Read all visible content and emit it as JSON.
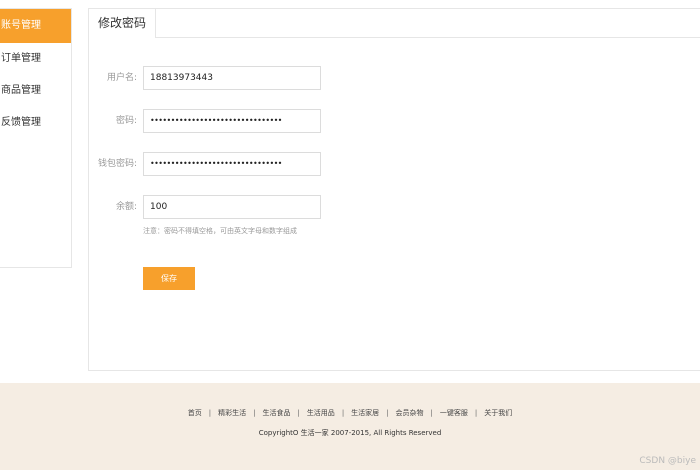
{
  "sidebar": {
    "items": [
      {
        "label": "账号管理"
      },
      {
        "label": "订单管理"
      },
      {
        "label": "商品管理"
      },
      {
        "label": "反馈管理"
      }
    ]
  },
  "panel": {
    "tab_label": "修改密码"
  },
  "form": {
    "username_label": "用户名:",
    "username_value": "18813973443",
    "password_label": "密码:",
    "password_value": "••••••••••••••••••••••••••••••••",
    "wallet_password_label": "钱包密码:",
    "wallet_password_value": "••••••••••••••••••••••••••••••••",
    "balance_label": "余额:",
    "balance_value": "100",
    "hint": "注意：密码不得填空格，可由英文字母和数字组成",
    "save_label": "保存"
  },
  "footer": {
    "links": [
      "首页",
      "精彩生活",
      "生活食品",
      "生活用品",
      "生活家居",
      "会员杂物",
      "一键客服",
      "关于我们"
    ],
    "copyright": "CopyrightO 生活一家 2007-2015, All Rights Reserved"
  },
  "watermark": "CSDN @biye",
  "colors": {
    "accent": "#f7a02c",
    "footer_bg": "#f5ede3"
  }
}
